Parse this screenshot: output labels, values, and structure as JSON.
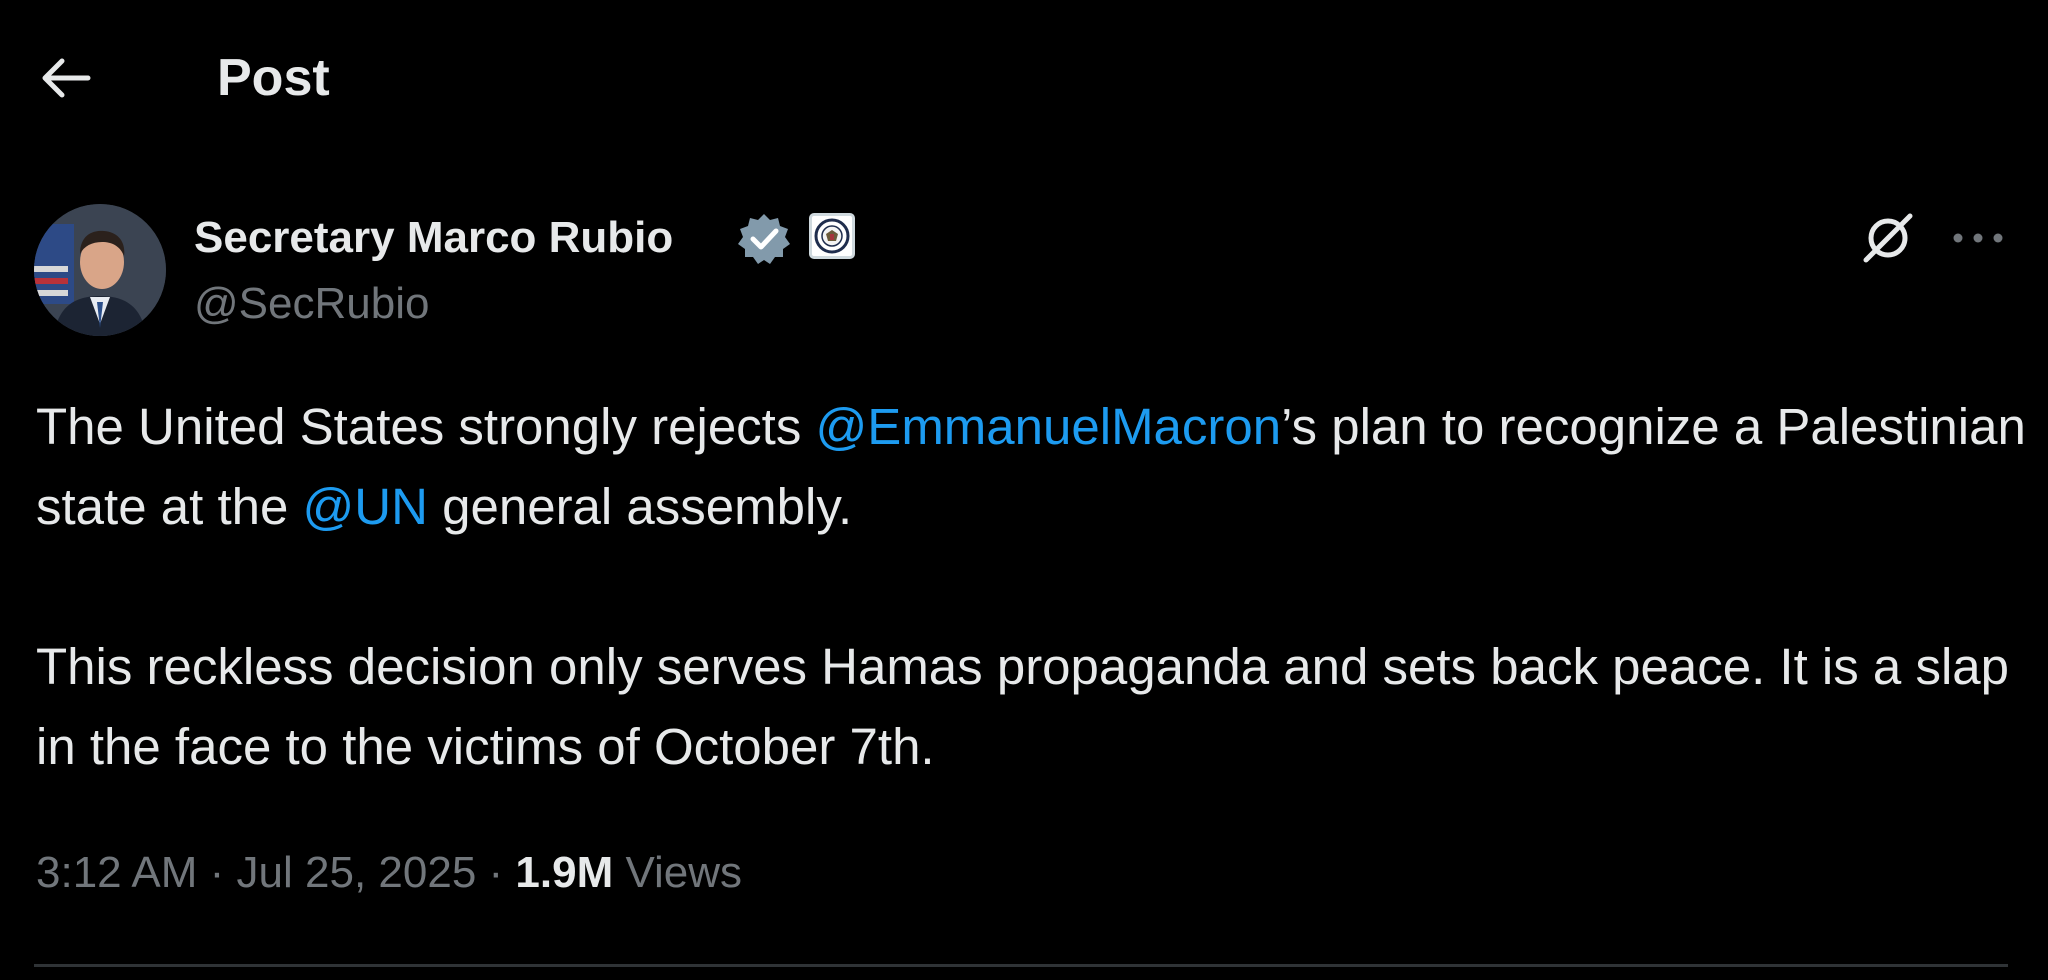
{
  "header": {
    "title": "Post"
  },
  "author": {
    "display_name": "Secretary Marco Rubio",
    "handle": "@SecRubio",
    "verified_color": "#829aab"
  },
  "tweet": {
    "p1": {
      "t1": "The United States strongly rejects ",
      "m1": "@EmmanuelMacron",
      "t2": "’s plan to recognize a Palestinian state at the ",
      "m2": "@UN",
      "t3": " general assembly."
    },
    "p2": "This reckless decision only serves Hamas propaganda and sets back peace. It is a slap in the face to the victims of October 7th."
  },
  "meta": {
    "time": "3:12 AM",
    "sep1": " · ",
    "date": "Jul 25, 2025",
    "sep2": " · ",
    "views_count": "1.9M",
    "views_label": " Views"
  },
  "icons": {
    "back": "arrow-left-icon",
    "verified": "verified-badge-icon",
    "affiliation": "state-department-seal-icon",
    "grok": "grok-icon",
    "more": "more-dots-icon"
  },
  "colors": {
    "background": "#000000",
    "text": "#e7e9ea",
    "secondary_text": "#71767b",
    "link": "#1d9bf0"
  }
}
